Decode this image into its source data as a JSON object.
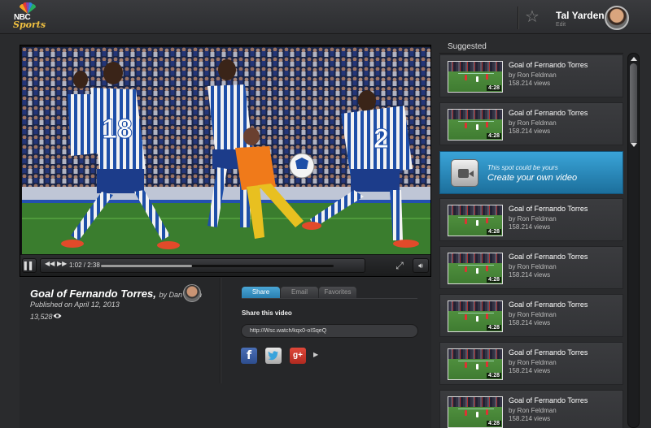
{
  "header": {
    "logo_text_top": "NBC",
    "logo_text_bottom": "Sports",
    "user_name": "Tal Yarden",
    "user_edit": "Edit"
  },
  "player": {
    "current_time": "1:02",
    "duration": "2:38",
    "progress_fraction": 0.39
  },
  "video_info": {
    "title": "Goal of Fernando Torres,",
    "by": "by Dan Levin",
    "published": "Published on April 12, 2013",
    "views": "13,528"
  },
  "share": {
    "tabs": [
      "Share",
      "Email",
      "Favorites"
    ],
    "label": "Share this video",
    "url": "http://Wsc.watch/kqx0-oISqeQ",
    "fb": "f",
    "gplus": "g+"
  },
  "sidebar": {
    "title": "Suggested",
    "promo_sub": "This spot could be yours",
    "promo_main": "Create your own video",
    "items": [
      {
        "title": "Goal of Fernando Torres",
        "author": "by Ron Feldman",
        "views": "158.214 views",
        "duration": "4:28"
      },
      {
        "title": "Goal of Fernando Torres",
        "author": "by Ron Feldman",
        "views": "158.214 views",
        "duration": "4:28"
      },
      {
        "title": "Goal of Fernando Torres",
        "author": "by Ron Feldman",
        "views": "158.214 views",
        "duration": "4:28"
      },
      {
        "title": "Goal of Fernando Torres",
        "author": "by Ron Feldman",
        "views": "158.214 views",
        "duration": "4:28"
      },
      {
        "title": "Goal of Fernando Torres",
        "author": "by Ron Feldman",
        "views": "158.214 views",
        "duration": "4:28"
      },
      {
        "title": "Goal of Fernando Torres",
        "author": "by Ron Feldman",
        "views": "158.214 views",
        "duration": "4:28"
      },
      {
        "title": "Goal of Fernando Torres",
        "author": "by Ron Feldman",
        "views": "158.214 views",
        "duration": "4:28"
      }
    ]
  }
}
